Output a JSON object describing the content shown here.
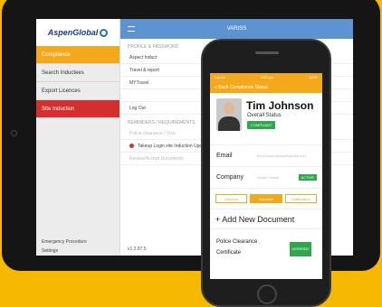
{
  "tablet": {
    "logo": "AspenGlobal",
    "sidebar": {
      "items": [
        {
          "label": "Compliance",
          "state": "active"
        },
        {
          "label": "Search Inductees",
          "state": ""
        },
        {
          "label": "Export Licences",
          "state": ""
        },
        {
          "label": "Site Induction",
          "state": "red"
        }
      ],
      "bottom": [
        "Emergency Procedure",
        "Settings"
      ]
    },
    "topbar_title": "VARISS",
    "sections": [
      {
        "title": "PROFILE & PASSWORD",
        "rows": [
          {
            "label": "Aspect Induct",
            "dot": false,
            "gray": false
          },
          {
            "label": "Travel & report",
            "dot": false,
            "gray": false
          },
          {
            "label": "MYTravel",
            "dot": false,
            "gray": false
          },
          {
            "label": "",
            "dot": false,
            "gray": false
          },
          {
            "label": "Log Out",
            "dot": false,
            "gray": false
          }
        ]
      },
      {
        "title": "REMINDERS / REQUIREMENTS",
        "rows": [
          {
            "label": "Police clearance / Visa",
            "dot": false,
            "gray": true
          },
          {
            "label": "Takeup Login site Induction Update",
            "dot": true,
            "gray": false
          },
          {
            "label": "Review/Accept Documents",
            "dot": false,
            "gray": true
          }
        ]
      }
    ],
    "footer": "v1.2.87.5"
  },
  "phone": {
    "status_left": "Carrier",
    "status_time": "4:00 pm",
    "status_right": "100%",
    "nav_title": "< Back  Compliance Status",
    "name": "Tim Johnson",
    "overall_status_label": "Overall Status",
    "overall_status_badge": "COMPLIANT",
    "email_label": "Email",
    "email_value": "tim.johnson@aspenglobal.com",
    "company_label": "Company",
    "company_value": "Aspen Global",
    "company_badge": "ACTIVE",
    "tabs": [
      "Licences",
      "Induction",
      "Certification"
    ],
    "active_tab": 1,
    "add_document": "Add New Document",
    "police_line1": "Police Clearance",
    "police_line2": "Certificate",
    "police_badge": "VERIFIED"
  }
}
